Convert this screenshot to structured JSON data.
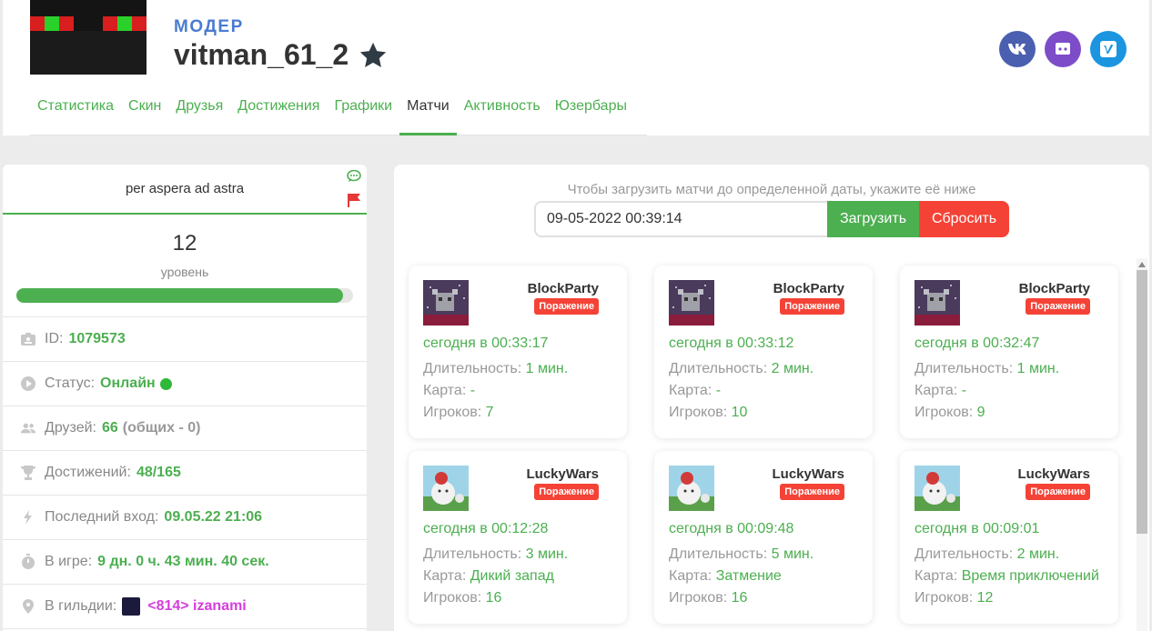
{
  "profile": {
    "role": "МОДЕР",
    "username": "vitman_61_2"
  },
  "socials": [
    {
      "name": "vk",
      "label": "vk",
      "color": "#4a5fb0"
    },
    {
      "name": "discord",
      "label": "discord",
      "color": "#7d4cc9"
    },
    {
      "name": "vimeo",
      "label": "vimeo",
      "color": "#1b95e0"
    }
  ],
  "nav": [
    "Статистика",
    "Скин",
    "Друзья",
    "Достижения",
    "Графики",
    "Матчи",
    "Активность",
    "Юзербары"
  ],
  "sidebar": {
    "motto": "per aspera ad astra",
    "level": "12",
    "level_label": "уровень",
    "level_progress": 0.97,
    "id_label": "ID:",
    "id_value": "1079573",
    "status_label": "Статус:",
    "status_value": "Онлайн",
    "friends_label": "Друзей:",
    "friends_value": "66",
    "friends_common": "(общих - 0)",
    "achievements_label": "Достижений:",
    "achievements_value": "48/165",
    "last_login_label": "Последний вход:",
    "last_login_value": "09.05.22 21:06",
    "ingame_label": "В игре:",
    "ingame_value": "9 дн. 0 ч. 43 мин. 40 сек.",
    "guild_label": "В гильдии:",
    "guild_value": "<814> izanami"
  },
  "matches_panel": {
    "hint": "Чтобы загрузить матчи до определенной даты, укажите её ниже",
    "date_value": "09-05-2022 00:39:14",
    "load_button": "Загрузить",
    "reset_button": "Сбросить"
  },
  "labels": {
    "duration": "Длительность:",
    "map": "Карта:",
    "players": "Игроков:"
  },
  "matches": [
    {
      "game": "BlockParty",
      "result": "Поражение",
      "time": "сегодня в 00:33:17",
      "duration": "1 мин.",
      "map": "-",
      "players": "7"
    },
    {
      "game": "BlockParty",
      "result": "Поражение",
      "time": "сегодня в 00:33:12",
      "duration": "2 мин.",
      "map": "-",
      "players": "10"
    },
    {
      "game": "BlockParty",
      "result": "Поражение",
      "time": "сегодня в 00:32:47",
      "duration": "1 мин.",
      "map": "-",
      "players": "9"
    },
    {
      "game": "LuckyWars",
      "result": "Поражение",
      "time": "сегодня в 00:12:28",
      "duration": "3 мин.",
      "map": "Дикий запад",
      "players": "16"
    },
    {
      "game": "LuckyWars",
      "result": "Поражение",
      "time": "сегодня в 00:09:48",
      "duration": "5 мин.",
      "map": "Затмение",
      "players": "16"
    },
    {
      "game": "LuckyWars",
      "result": "Поражение",
      "time": "сегодня в 00:09:01",
      "duration": "2 мин.",
      "map": "Время приключений",
      "players": "12"
    }
  ]
}
